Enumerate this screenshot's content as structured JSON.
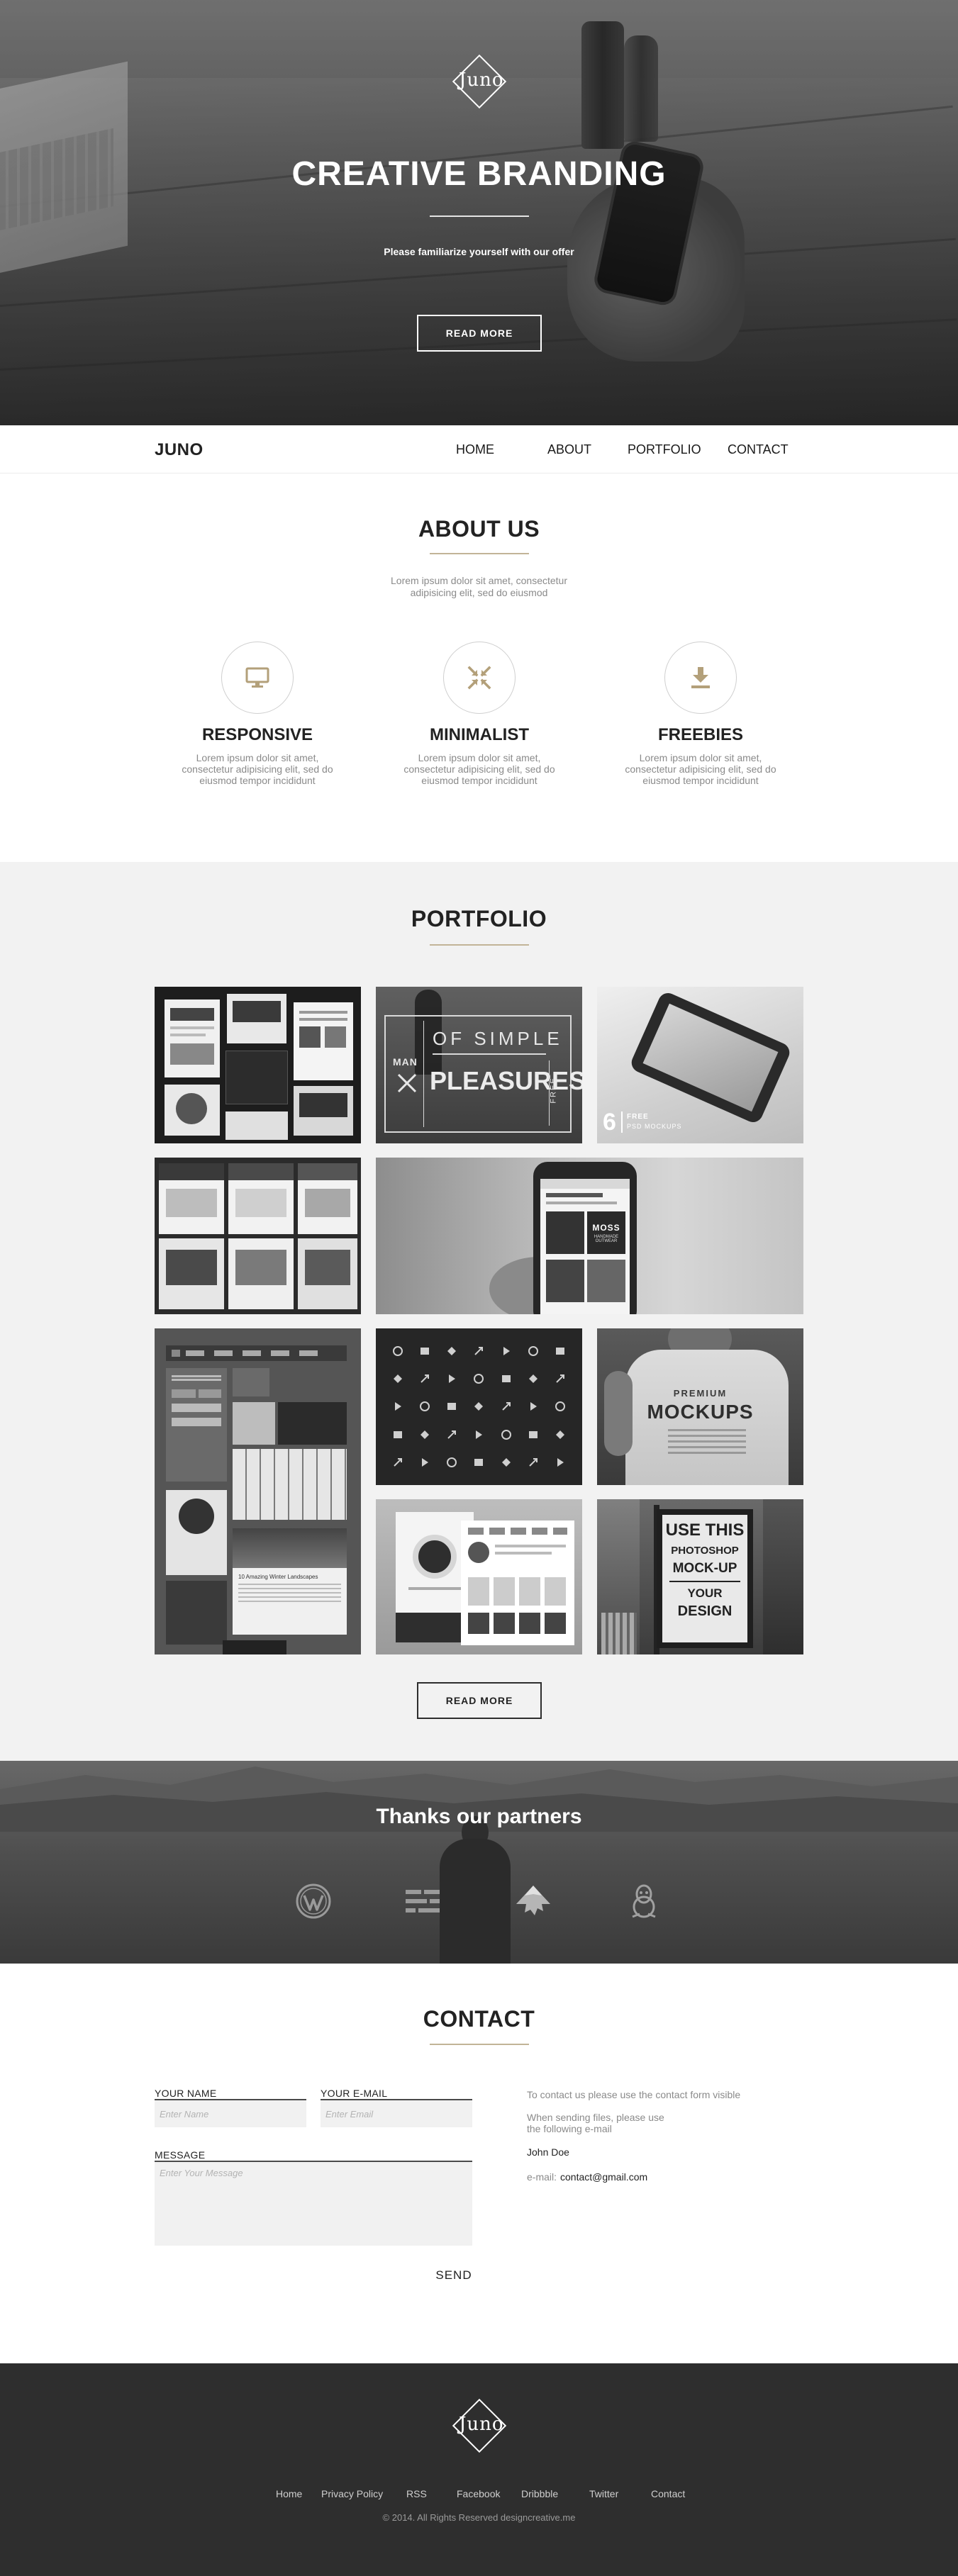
{
  "hero": {
    "logo_text": "Juno",
    "title": "CREATIVE BRANDING",
    "subtitle": "Please familiarize yourself with our offer",
    "button_label": "READ MORE"
  },
  "nav": {
    "brand": "JUNO",
    "links": [
      "HOME",
      "ABOUT",
      "PORTFOLIO",
      "CONTACT"
    ]
  },
  "about": {
    "title": "ABOUT US",
    "intro": "Lorem ipsum dolor sit amet, consectetur adipisicing elit, sed do eiusmod",
    "features": [
      {
        "icon": "monitor-icon",
        "title": "RESPONSIVE",
        "text": "Lorem ipsum dolor sit amet, consectetur adipisicing elit, sed do eiusmod tempor incididunt"
      },
      {
        "icon": "compress-icon",
        "title": "MINIMALIST",
        "text": "Lorem ipsum dolor sit amet, consectetur adipisicing elit, sed do eiusmod tempor incididunt"
      },
      {
        "icon": "download-icon",
        "title": "FREEBIES",
        "text": "Lorem ipsum dolor sit amet, consectetur adipisicing elit, sed do eiusmod tempor incididunt"
      }
    ]
  },
  "portfolio": {
    "title": "PORTFOLIO",
    "button_label": "READ MORE",
    "tile_texts": {
      "pleasures_top": "OF SIMPLE",
      "pleasures_main": "PLEASURES",
      "pleasures_man": "MAN",
      "pleasures_free": "FREE",
      "phone_num": "6",
      "phone_free": "FREE",
      "phone_sub": "PSD MOCKUPS",
      "moss_name": "MOSS",
      "moss_sub": "HANDMADE OUTWEAR",
      "tshirt_premium": "PREMIUM",
      "tshirt_mockups": "MOCKUPS",
      "poster_lines": [
        "USE THIS",
        "PHOTOSHOP",
        "MOCK-UP",
        "YOUR",
        "DESIGN"
      ],
      "blog_title": "10 Amazing Winter Landscapes"
    }
  },
  "partners": {
    "title": "Thanks our partners",
    "icons": [
      "wordpress-icon",
      "menu-logo-icon",
      "inkscape-icon",
      "linux-icon"
    ]
  },
  "contact": {
    "title": "CONTACT",
    "name_label": "YOUR NAME",
    "name_placeholder": "Enter Name",
    "email_label": "YOUR E-MAIL",
    "email_placeholder": "Enter Email",
    "message_label": "MESSAGE",
    "message_placeholder": "Enter Your Message",
    "send_label": "SEND",
    "info_line1": "To contact us please use the contact form visible",
    "info_line2a": "When sending files, please use",
    "info_line2b": "the following e-mail",
    "person": "John Doe",
    "email_prefix": "e-mail:",
    "email": "contact@gmail.com"
  },
  "footer": {
    "logo_text": "Juno",
    "links": [
      "Home",
      "Privacy Policy",
      "RSS",
      "Facebook",
      "Dribbble",
      "Twitter",
      "Contact"
    ],
    "copyright": "© 2014. All Rights Reserved designcreative.me"
  },
  "colors": {
    "accent": "#c2b497",
    "dark": "#2e2e2e",
    "light_bg": "#f2f2f2"
  }
}
